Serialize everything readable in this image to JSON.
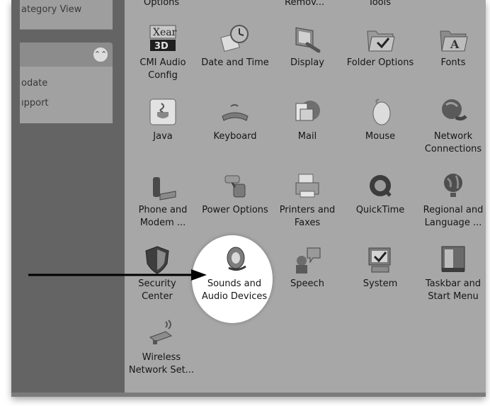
{
  "left_pane": {
    "category_view": "ategory View",
    "links": [
      "odate",
      "ıpport"
    ]
  },
  "top_row": [
    "Options",
    "Remov...",
    "Tools"
  ],
  "items": [
    {
      "label": "CMI Audio\nConfig",
      "icon": "cmi-audio-icon"
    },
    {
      "label": "Date and Time",
      "icon": "date-time-icon"
    },
    {
      "label": "Display",
      "icon": "display-icon"
    },
    {
      "label": "Folder Options",
      "icon": "folder-options-icon"
    },
    {
      "label": "Fonts",
      "icon": "fonts-icon"
    },
    {
      "label": "Java",
      "icon": "java-icon"
    },
    {
      "label": "Keyboard",
      "icon": "keyboard-icon"
    },
    {
      "label": "Mail",
      "icon": "mail-icon"
    },
    {
      "label": "Mouse",
      "icon": "mouse-icon"
    },
    {
      "label": "Network\nConnections",
      "icon": "network-connections-icon"
    },
    {
      "label": "Phone and\nModem ...",
      "icon": "phone-modem-icon"
    },
    {
      "label": "Power Options",
      "icon": "power-options-icon"
    },
    {
      "label": "Printers and\nFaxes",
      "icon": "printers-faxes-icon"
    },
    {
      "label": "QuickTime",
      "icon": "quicktime-icon"
    },
    {
      "label": "Regional and\nLanguage ...",
      "icon": "regional-language-icon"
    },
    {
      "label": "Security\nCenter",
      "icon": "security-center-icon"
    },
    {
      "label": "Sounds and\nAudio Devices",
      "icon": "sounds-audio-icon"
    },
    {
      "label": "Speech",
      "icon": "speech-icon"
    },
    {
      "label": "System",
      "icon": "system-icon"
    },
    {
      "label": "Taskbar and\nStart Menu",
      "icon": "taskbar-start-menu-icon"
    },
    {
      "label": "Wireless\nNetwork Set...",
      "icon": "wireless-network-icon"
    }
  ],
  "highlight": {
    "target": "Sounds and Audio Devices",
    "marker": "spotlight-arrow"
  }
}
